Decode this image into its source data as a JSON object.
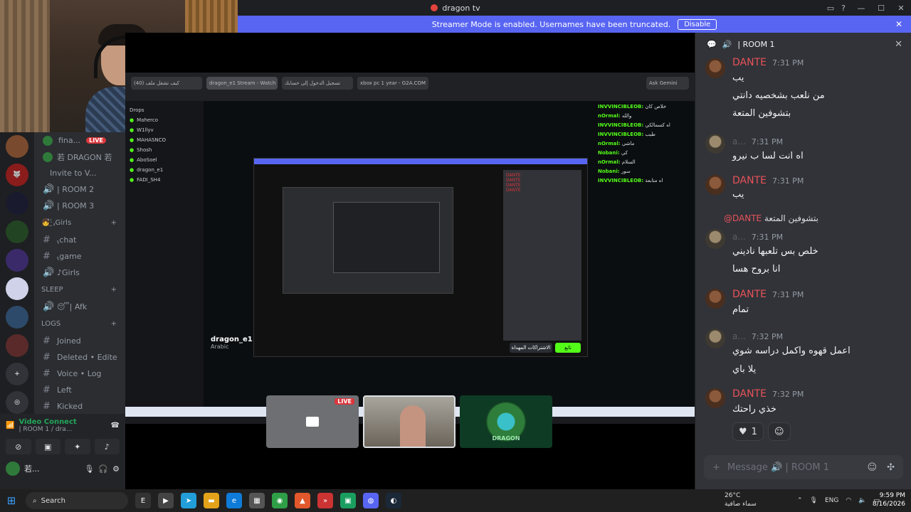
{
  "window": {
    "title": "dragon tv"
  },
  "banner": {
    "text": "Streamer Mode is enabled. Usernames have been truncated.",
    "disable_label": "Disable"
  },
  "channels": {
    "live_channel": "fina...",
    "live_badge": "LIVE",
    "live_member": "若 DRAGON 若",
    "invite": "Invite to V...",
    "rooms": [
      "| ROOM 2",
      "| ROOM 3"
    ],
    "girls_category": "👧̊·̱́⸥Girls",
    "girls_channels": [
      "⹛chat",
      "⹛game",
      "♪Girls"
    ],
    "sleep_category": "SLEEP",
    "sleep_channels": [
      "😴| Afk"
    ],
    "logs_category": "LOGS",
    "logs_channels": [
      "Joined",
      "Deleted • Edite",
      "Voice • Log",
      "Left",
      "Kicked"
    ]
  },
  "voice_panel": {
    "title": "Video Connect",
    "subtitle": "| ROOM 1 / dra...",
    "user": "若..."
  },
  "nested_screen": {
    "tabs": [
      "كيف تشغل ملف (40)",
      "dragon_e1 Stream - Watch Li...",
      "تسجيل الدخول إلى حسابك",
      "xbox pc 1 year - G2A.COM"
    ],
    "ask": "Ask Gemini",
    "kick_sidebar": [
      "Maherco",
      "W1llyv",
      "MAHASNCO",
      "Shosh",
      "AboSoel",
      "dragon_e1",
      "FADI_SH4"
    ],
    "drops": "Drops",
    "kick_chat": [
      {
        "n": "INVVINCIBLEOB:",
        "t": "خلاص كان"
      },
      {
        "n": "nOrmal:",
        "t": "والله"
      },
      {
        "n": "INVVINCIBLEOB:",
        "t": "اه كسمالكي"
      },
      {
        "n": "INVVINCIBLEOB:",
        "t": "طيب"
      },
      {
        "n": "nOrmal:",
        "t": "ماشي"
      },
      {
        "n": "Nobani:",
        "t": "كي"
      },
      {
        "n": "nOrmal:",
        "t": "السلام"
      },
      {
        "n": "Nobani:",
        "t": "سور"
      },
      {
        "n": "INVVINCIBLEOB:",
        "t": "اه متابعة"
      }
    ],
    "streamer_name": "dragon_e1",
    "language": "Arabic",
    "follow": "تابع",
    "subscribe": "الاشتراكات المهداة"
  },
  "tiles": {
    "live_badge": "LIVE",
    "dragon_label": "DRAGON"
  },
  "chat": {
    "room": "| ROOM 1",
    "messages": [
      {
        "user": "DANTE",
        "time": "7:31 PM",
        "lines": [
          "يب",
          "من نلعب بشخصيه دانتي",
          "بتشوفين المتعة"
        ]
      },
      {
        "user": "a...",
        "time": "7:31 PM",
        "lines": [
          "اه انت لسا ب نيرو"
        ]
      },
      {
        "user": "DANTE",
        "time": "7:31 PM",
        "lines": [
          "يب"
        ]
      },
      {
        "reply_mention": "@DANTE",
        "reply_text": "بتشوفين المتعة",
        "user": "a...",
        "time": "7:31 PM",
        "lines": [
          "خلص بس تلعبها ناديني",
          "انا بروح هسا"
        ]
      },
      {
        "user": "DANTE",
        "time": "7:31 PM",
        "lines": [
          "تمام"
        ]
      },
      {
        "user": "a...",
        "time": "7:32 PM",
        "lines": [
          "اعمل قهوه واكمل دراسه شوي",
          "يلا باي"
        ]
      },
      {
        "user": "DANTE",
        "time": "7:32 PM",
        "lines": [
          "خذي راحتك"
        ]
      }
    ],
    "reaction_count": "1",
    "input_placeholder": "Message 🔊 | ROOM 1"
  },
  "taskbar": {
    "search": "Search",
    "weather_temp": "26°C",
    "weather_desc": "سماء صافية",
    "lang": "ENG",
    "time": "9:59 PM",
    "date": "8/16/2026"
  }
}
